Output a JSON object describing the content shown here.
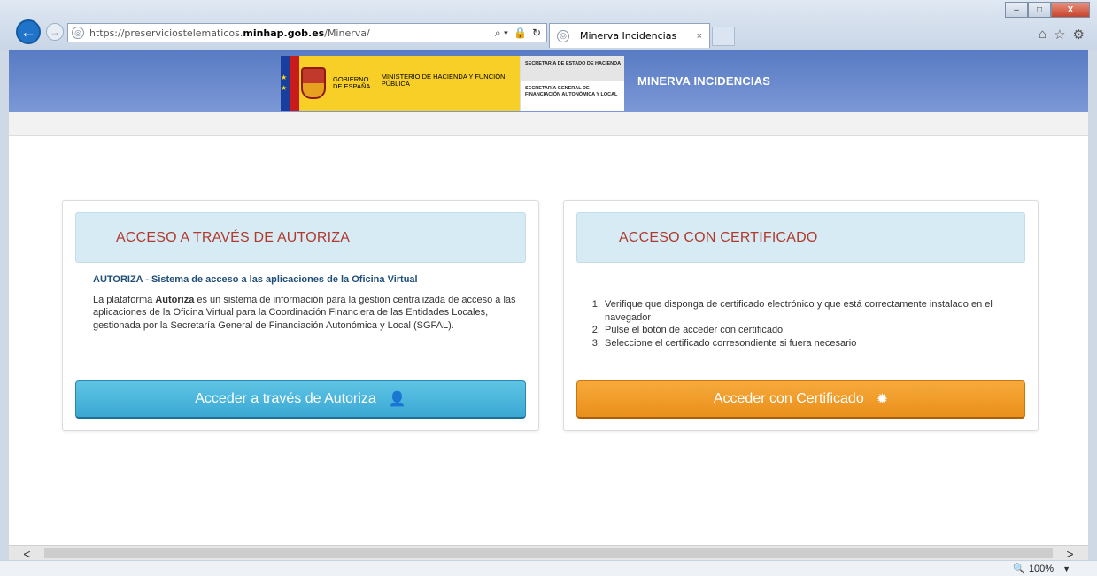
{
  "browser": {
    "url_prefix": "https://preserviciostelematicos.",
    "url_domain": "minhap.gob.es",
    "url_path": "/Minerva/",
    "tab_title": "Minerva Incidencias",
    "tab_close": "×",
    "back_icon": "arrow-left-icon",
    "forward_icon": "arrow-right-icon",
    "search_glyph": "⌕ ▾",
    "lock_glyph": "🔒",
    "refresh_glyph": "↻",
    "home_glyph": "⌂",
    "star_glyph": "☆",
    "gear_glyph": "⚙",
    "minimize": "–",
    "maximize": "□",
    "close": "X"
  },
  "banner": {
    "gobierno": "GOBIERNO DE ESPAÑA",
    "ministerio": "MINISTERIO DE HACIENDA Y FUNCIÓN PÚBLICA",
    "secretaria_estado": "SECRETARÍA DE ESTADO DE HACIENDA",
    "secretaria_general": "SECRETARÍA GENERAL DE FINANCIACIÓN AUTONÓMICA Y LOCAL",
    "title": "MINERVA INCIDENCIAS",
    "eu_stars": "★ ★",
    "brand_colors": {
      "banner": "#6b8bcf",
      "gov_yellow": "#f7cf26"
    }
  },
  "autoriza_panel": {
    "title": "ACCESO A TRAVÉS DE AUTORIZA",
    "subtitle": "AUTORIZA - Sistema de acceso a las aplicaciones de la Oficina Virtual",
    "desc_pre": "La plataforma ",
    "desc_bold": "Autoriza",
    "desc_post": " es un sistema de información para la gestión centralizada de acceso a las aplicaciones de la Oficina Virtual para la Coordinación Financiera de las Entidades Locales, gestionada por la Secretaría General de Financiación Autonómica y Local (SGFAL).",
    "button_label": "Acceder a través de Autoriza",
    "button_icon": "user-icon",
    "button_glyph": "👤",
    "button_color": "#3ba8d4"
  },
  "cert_panel": {
    "title": "ACCESO CON CERTIFICADO",
    "steps": [
      "Verifique que disponga de certificado electrónico y que está correctamente instalado en el navegador",
      "Pulse el botón de acceder con certificado",
      "Seleccione el certificado corresondiente si fuera necesario"
    ],
    "button_label": "Acceder con Certificado",
    "button_icon": "certificate-icon",
    "button_glyph": "✹",
    "button_color": "#ea8f1c"
  },
  "scroll": {
    "left_arrow": "<",
    "right_arrow": ">"
  },
  "status": {
    "zoom_glyph": "🔍",
    "zoom": "100%",
    "zoom_caret": "▼"
  }
}
